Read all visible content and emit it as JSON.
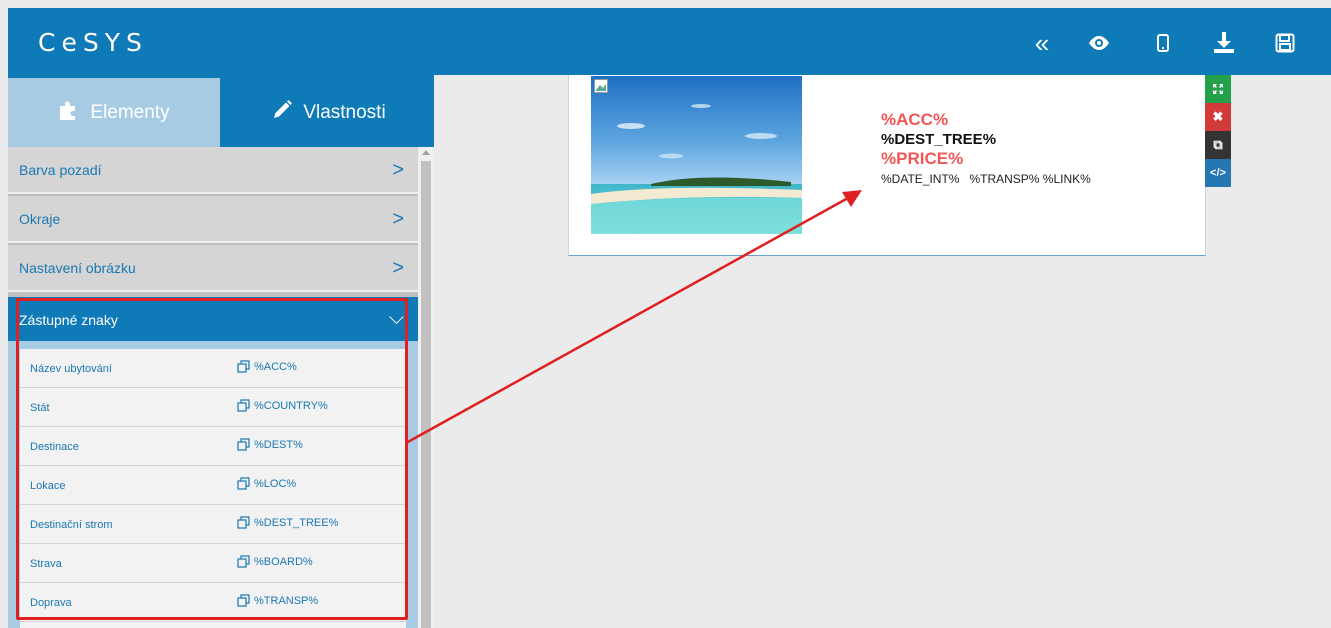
{
  "app": {
    "title": "CeSYS"
  },
  "toolbar": {
    "collapse": "«",
    "icons": [
      "chevron-double-left-icon",
      "eye-icon",
      "mobile-icon",
      "download-icon",
      "save-icon"
    ]
  },
  "tabs": {
    "elementy": "Elementy",
    "vlastnosti": "Vlastnosti"
  },
  "accordion": [
    {
      "label": "Barva pozadí",
      "chevron": ">"
    },
    {
      "label": "Okraje",
      "chevron": ">"
    },
    {
      "label": "Nastavení obrázku",
      "chevron": ">"
    },
    {
      "label": "Zástupné znaky",
      "chevron": "⌵"
    }
  ],
  "placeholders": [
    {
      "name": "Název ubytování",
      "code": "%ACC%"
    },
    {
      "name": "Stát",
      "code": "%COUNTRY%"
    },
    {
      "name": "Destinace",
      "code": "%DEST%"
    },
    {
      "name": "Lokace",
      "code": "%LOC%"
    },
    {
      "name": "Destinační strom",
      "code": "%DEST_TREE%"
    },
    {
      "name": "Strava",
      "code": "%BOARD%"
    },
    {
      "name": "Doprava",
      "code": "%TRANSP%"
    }
  ],
  "preview": {
    "acc": "%ACC%",
    "dest_tree": "%DEST_TREE%",
    "price": "%PRICE%",
    "meta": "%DATE_INT%   %TRANSP% %LINK%"
  },
  "tools": {
    "copy": "⧉",
    "code": "</>"
  },
  "colors": {
    "brand": "#0f7ab8",
    "accent_red": "#f05656",
    "highlight": "#e02020"
  }
}
